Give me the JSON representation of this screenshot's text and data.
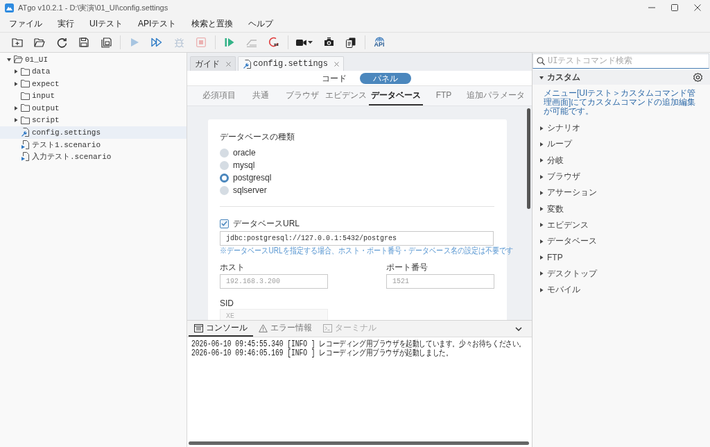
{
  "window": {
    "title": "ATgo v10.2.1 - D:\\実演\\01_UI\\config.settings"
  },
  "menu": [
    "ファイル",
    "実行",
    "UIテスト",
    "APIテスト",
    "検索と置換",
    "ヘルプ"
  ],
  "toolbar": [
    [
      {
        "kind": "new-folder",
        "disabled": false
      },
      {
        "kind": "open-folder",
        "disabled": false
      },
      {
        "kind": "refresh",
        "disabled": false
      },
      {
        "kind": "save",
        "disabled": false
      },
      {
        "kind": "save-all",
        "disabled": false
      }
    ],
    [
      {
        "kind": "run",
        "disabled": true
      },
      {
        "kind": "run-all",
        "disabled": false
      },
      {
        "kind": "debug",
        "disabled": true
      },
      {
        "kind": "stop",
        "disabled": true
      }
    ],
    [
      {
        "kind": "record-run",
        "disabled": false
      },
      {
        "kind": "ramp",
        "disabled": true
      },
      {
        "kind": "stop-record",
        "disabled": false
      }
    ],
    [
      {
        "kind": "video",
        "disabled": false
      },
      {
        "kind": "screenshot",
        "disabled": false
      },
      {
        "kind": "copy",
        "disabled": false
      }
    ],
    [
      {
        "kind": "api",
        "label": "API",
        "disabled": false
      }
    ]
  ],
  "file_tree": [
    {
      "label": "01_UI",
      "kind": "folder",
      "expandable": true,
      "expanded": true,
      "selected": false,
      "children": [
        {
          "label": "data",
          "kind": "folder",
          "expandable": true,
          "expanded": false,
          "selected": false
        },
        {
          "label": "expect",
          "kind": "folder",
          "expandable": true,
          "expanded": false,
          "selected": false
        },
        {
          "label": "input",
          "kind": "folder",
          "expandable": false,
          "expanded": false,
          "selected": false
        },
        {
          "label": "output",
          "kind": "folder",
          "expandable": true,
          "expanded": false,
          "selected": false
        },
        {
          "label": "script",
          "kind": "folder",
          "expandable": true,
          "expanded": false,
          "selected": false
        },
        {
          "label": "config.settings",
          "kind": "settings",
          "selected": true
        },
        {
          "label": "テスト1.scenario",
          "kind": "scenario",
          "selected": false
        },
        {
          "label": "入力テスト.scenario",
          "kind": "scenario",
          "selected": false
        }
      ]
    }
  ],
  "editor": {
    "tabs": [
      {
        "label": "ガイド",
        "kind": "text",
        "selected": false
      },
      {
        "label": "config.settings",
        "kind": "settings",
        "selected": true
      }
    ],
    "view_modes": [
      {
        "label": "コード",
        "selected": false
      },
      {
        "label": "パネル",
        "selected": true
      }
    ],
    "sections": [
      {
        "label": "必須項目",
        "selected": false
      },
      {
        "label": "共通",
        "selected": false
      },
      {
        "label": "ブラウザ",
        "selected": false
      },
      {
        "label": "エビデンス",
        "selected": false
      },
      {
        "label": "データベース",
        "selected": true
      },
      {
        "label": "FTP",
        "selected": false
      },
      {
        "label": "追加パラメータ",
        "selected": false
      }
    ],
    "form": {
      "db_type_label": "データベースの種類",
      "db_types": [
        {
          "label": "oracle",
          "selected": false
        },
        {
          "label": "mysql",
          "selected": false
        },
        {
          "label": "postgresql",
          "selected": true
        },
        {
          "label": "sqlserver",
          "selected": false
        }
      ],
      "url": {
        "label": "データベースURL",
        "checked": true,
        "value": "jdbc:postgresql://127.0.0.1:5432/postgres",
        "note": "※データベースURLを指定する場合、ホスト・ポート番号・データベース名の設定は不要です"
      },
      "host": {
        "label": "ホスト",
        "placeholder": "192.168.3.200",
        "disabled": false
      },
      "port": {
        "label": "ポート番号",
        "placeholder": "1521",
        "disabled": false
      },
      "sid": {
        "label": "SID",
        "placeholder": "XE",
        "disabled": true
      }
    }
  },
  "console": {
    "tabs": [
      {
        "label": "コンソール",
        "kind": "console",
        "selected": true,
        "disabled": false
      },
      {
        "label": "エラー情報",
        "kind": "error",
        "selected": false,
        "disabled": false
      },
      {
        "label": "ターミナル",
        "kind": "terminal",
        "selected": false,
        "disabled": true
      }
    ],
    "lines": [
      "2026-06-10 09:45:55.340 [INFO ] レコーディング用ブラウザを起動しています。少々お待ちください。",
      "2026-06-10 09:46:05.169 [INFO ] レコーディング用ブラウザが起動しました。"
    ]
  },
  "commands": {
    "search": {
      "placeholder": "UIテストコマンド検索"
    },
    "categories": [
      {
        "label": "カスタム",
        "kind": "custom",
        "expanded": true,
        "note": "メニュー[UIテスト＞カスタムコマンド管理画面]にてカスタムコマンドの追加編集が可能です。"
      },
      {
        "label": "シナリオ",
        "kind": "standard",
        "expanded": false
      },
      {
        "label": "ループ",
        "kind": "standard",
        "expanded": false
      },
      {
        "label": "分岐",
        "kind": "standard",
        "expanded": false
      },
      {
        "label": "ブラウザ",
        "kind": "standard",
        "expanded": false
      },
      {
        "label": "アサーション",
        "kind": "standard",
        "expanded": false
      },
      {
        "label": "変数",
        "kind": "standard",
        "expanded": false
      },
      {
        "label": "エビデンス",
        "kind": "standard",
        "expanded": false
      },
      {
        "label": "データベース",
        "kind": "standard",
        "expanded": false
      },
      {
        "label": "FTP",
        "kind": "standard",
        "expanded": false
      },
      {
        "label": "デスクトップ",
        "kind": "standard",
        "expanded": false
      },
      {
        "label": "モバイル",
        "kind": "standard",
        "expanded": false
      }
    ]
  }
}
